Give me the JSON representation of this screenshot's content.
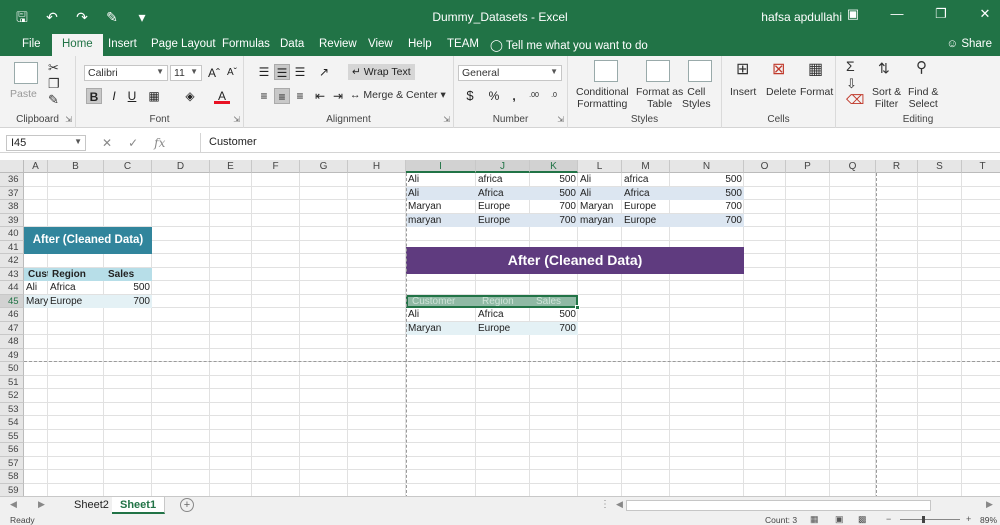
{
  "window": {
    "title": "Dummy_Datasets  -  Excel",
    "user": "hafsa apdullahi",
    "qat_icons": [
      "save-icon",
      "undo-icon",
      "redo-icon",
      "format-painter-icon",
      "customize-qat-icon"
    ],
    "controls": [
      "ribbon-display-icon",
      "minimize-icon",
      "restore-icon",
      "close-icon"
    ]
  },
  "tabs": [
    "File",
    "Home",
    "Insert",
    "Page Layout",
    "Formulas",
    "Data",
    "Review",
    "View",
    "Help",
    "TEAM"
  ],
  "active_tab": "Home",
  "tellme": "Tell me what you want to do",
  "share": "Share",
  "ribbon": {
    "clipboard": {
      "label": "Clipboard",
      "paste": "Paste"
    },
    "font": {
      "label": "Font",
      "name": "Calibri",
      "size": "11"
    },
    "alignment": {
      "label": "Alignment",
      "wrap": "Wrap Text",
      "merge": "Merge & Center"
    },
    "number": {
      "label": "Number",
      "format": "General"
    },
    "styles": {
      "label": "Styles",
      "conditional": "Conditional",
      "conditional2": "Formatting",
      "format_as": "Format as",
      "format_as2": "Table",
      "cell_styles": "Cell",
      "cell_styles2": "Styles"
    },
    "cells": {
      "label": "Cells",
      "insert": "Insert",
      "delete": "Delete",
      "format": "Format"
    },
    "editing": {
      "label": "Editing",
      "sort": "Sort &",
      "sort2": "Filter",
      "find": "Find &",
      "find2": "Select"
    }
  },
  "formula_bar": {
    "name_box": "I45",
    "fx": "fx",
    "content": "Customer"
  },
  "columns": [
    "A",
    "B",
    "C",
    "D",
    "E",
    "F",
    "G",
    "H",
    "I",
    "J",
    "K",
    "L",
    "M",
    "N",
    "O",
    "P",
    "Q",
    "R",
    "S",
    "T"
  ],
  "selected_columns": [
    "I",
    "J",
    "K"
  ],
  "rows": [
    "36",
    "37",
    "38",
    "39",
    "40",
    "41",
    "42",
    "43",
    "44",
    "45",
    "46",
    "47",
    "48",
    "49",
    "50",
    "51",
    "52",
    "53",
    "54",
    "55",
    "56",
    "57",
    "58",
    "59"
  ],
  "selected_row": "45",
  "left_table": {
    "band": "After (Cleaned Data)",
    "headers": [
      "Customer",
      "Region",
      "Sales"
    ],
    "rows": [
      [
        "Ali",
        "Africa",
        "500"
      ],
      [
        "Maryan",
        "Europe",
        "700"
      ]
    ]
  },
  "top_table": {
    "rows": [
      [
        "Ali",
        "africa",
        "500",
        "Ali",
        "africa",
        "500"
      ],
      [
        "Ali",
        "Africa",
        "500",
        "Ali",
        "Africa",
        "500"
      ],
      [
        "Maryan",
        "Europe",
        "700",
        "Maryan",
        "Europe",
        "700"
      ],
      [
        "maryan",
        "Europe",
        "700",
        "maryan",
        "Europe",
        "700"
      ]
    ]
  },
  "right_table": {
    "band": "After (Cleaned Data)",
    "headers": [
      "Customer",
      "Region",
      "Sales"
    ],
    "rows": [
      [
        "Ali",
        "Africa",
        "500"
      ],
      [
        "Maryan",
        "Europe",
        "700"
      ]
    ]
  },
  "sheets": [
    "Sheet2",
    "Sheet1"
  ],
  "active_sheet": "Sheet1",
  "status": {
    "ready": "Ready",
    "count": "Count: 3",
    "zoom": "89%"
  },
  "colors": {
    "excel_green": "#217346",
    "teal_band": "#31859c",
    "purple_band": "#5f3b7f",
    "header_fill": "#b7dee8",
    "alt_row": "#dce6f1"
  }
}
